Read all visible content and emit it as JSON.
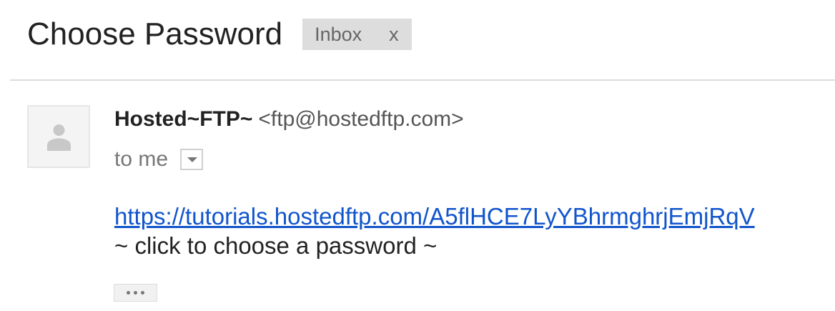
{
  "thread": {
    "subject": "Choose Password",
    "label": {
      "name": "Inbox",
      "remove_text": "x"
    }
  },
  "message": {
    "sender_name": "Hosted~FTP~",
    "sender_email": "<ftp@hostedftp.com>",
    "recipient_text": "to me",
    "link_text": "https://tutorials.hostedftp.com/A5flHCE7LyYBhrmghrjEmjRqV",
    "note_text": "~ click to choose a password ~"
  },
  "icons": {
    "avatar": "default-person-icon",
    "details": "dropdown-arrow-icon",
    "expand": "ellipsis-icon"
  },
  "colors": {
    "link": "#1155cc",
    "label_chip_bg": "#dddddd",
    "avatar_bg": "#f4f4f4",
    "text": "#222222",
    "muted_text": "#777777"
  }
}
